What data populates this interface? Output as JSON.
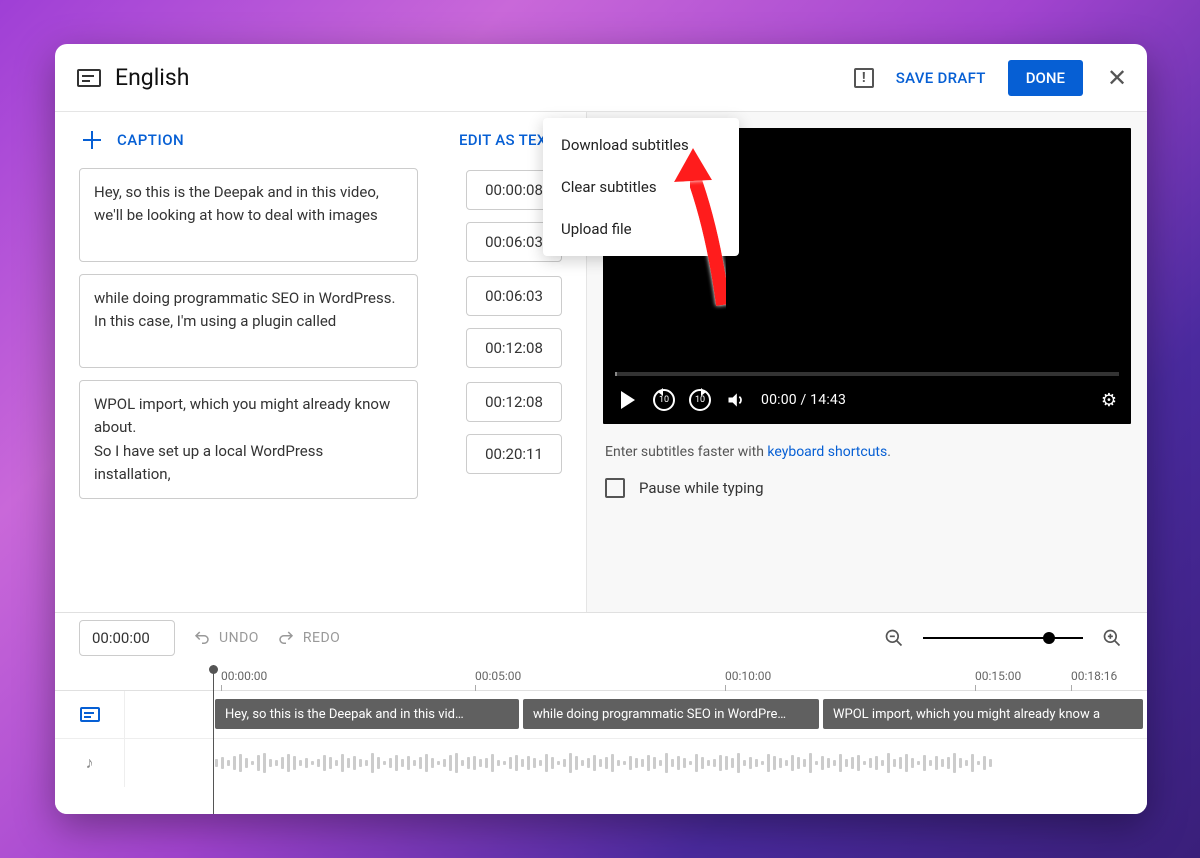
{
  "header": {
    "title": "English",
    "save_draft": "SAVE DRAFT",
    "done": "DONE"
  },
  "toolbar": {
    "add_caption": "CAPTION",
    "edit_as_text": "EDIT AS TEXT"
  },
  "captions": [
    {
      "text": "Hey, so this is the Deepak and in this video,\nwe'll be looking at how to deal with images",
      "start": "00:00:08",
      "end": "00:06:03"
    },
    {
      "text": "while doing programmatic SEO in WordPress.\nIn this case, I'm using a plugin called",
      "start": "00:06:03",
      "end": "00:12:08"
    },
    {
      "text": "WPOL import, which you might already know about.\nSo I have set up a local WordPress installation,",
      "start": "00:12:08",
      "end": "00:20:11"
    }
  ],
  "menu": {
    "download": "Download subtitles",
    "clear": "Clear subtitles",
    "upload": "Upload file"
  },
  "player": {
    "time": "00:00 / 14:43",
    "skip": "10"
  },
  "hint": {
    "prefix": "Enter subtitles faster with ",
    "link": "keyboard shortcuts",
    "suffix": "."
  },
  "pause_label": "Pause while typing",
  "bottom": {
    "time_input": "00:00:00",
    "undo": "UNDO",
    "redo": "REDO"
  },
  "ruler": {
    "t0": "00:00:00",
    "t1": "00:05:00",
    "t2": "00:10:00",
    "t3": "00:15:00",
    "t4": "00:18:16"
  },
  "clips": {
    "c0": "Hey, so this is the Deepak and in this vid…",
    "c1": "while doing programmatic SEO in WordPre…",
    "c2": "WPOL import, which you might already know a"
  }
}
